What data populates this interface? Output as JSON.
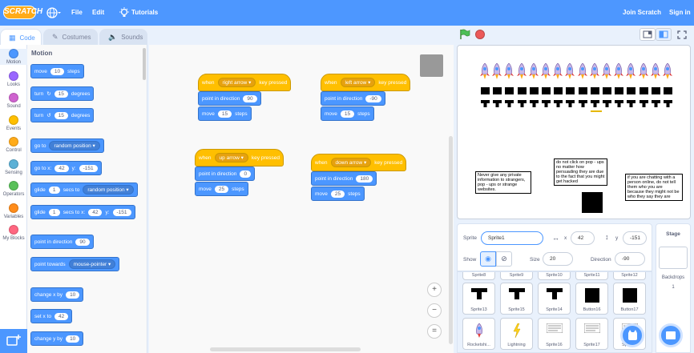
{
  "menu": {
    "logo": "SCRATCH",
    "file": "File",
    "edit": "Edit",
    "tutorials": "Tutorials",
    "join": "Join Scratch",
    "signin": "Sign in"
  },
  "tabs": {
    "code": "Code",
    "costumes": "Costumes",
    "sounds": "Sounds"
  },
  "categories": [
    {
      "label": "Motion",
      "color": "#4c97ff"
    },
    {
      "label": "Looks",
      "color": "#9966ff"
    },
    {
      "label": "Sound",
      "color": "#cf63cf"
    },
    {
      "label": "Events",
      "color": "#ffbf00"
    },
    {
      "label": "Control",
      "color": "#ffab19"
    },
    {
      "label": "Sensing",
      "color": "#5cb1d6"
    },
    {
      "label": "Operators",
      "color": "#59c059"
    },
    {
      "label": "Variables",
      "color": "#ff8c1a"
    },
    {
      "label": "My Blocks",
      "color": "#ff6680"
    }
  ],
  "palette": {
    "heading": "Motion",
    "move": "move",
    "move_val": "10",
    "steps": "steps",
    "turn": "turn",
    "turn_cw_val": "15",
    "turn_ccw_val": "15",
    "degrees": "degrees",
    "goto": "go to",
    "goto_opt": "random position",
    "gotoxy": "go to x:",
    "gotoxy_x": "42",
    "gotoxy_y_lbl": "y:",
    "gotoxy_y": "-151",
    "glide": "glide",
    "glide_val": "1",
    "secs_to": "secs to",
    "glide_opt": "random position",
    "glide2_val": "1",
    "glide2_x_lbl": "secs to x:",
    "glide2_x": "42",
    "glide2_y_lbl": "y:",
    "glide2_y": "-151",
    "point_dir": "point in direction",
    "point_dir_val": "90",
    "point_towards": "point towards",
    "point_towards_opt": "mouse-pointer",
    "change_x": "change x by",
    "change_x_val": "10",
    "set_x": "set x to",
    "set_x_val": "42",
    "change_y": "change y by",
    "change_y_val": "10"
  },
  "scripts": [
    {
      "when": "when",
      "key": "right arrow",
      "pressed": "key pressed",
      "point": "point in direction",
      "dir": "90",
      "move": "move",
      "steps_val": "15",
      "steps": "steps"
    },
    {
      "when": "when",
      "key": "left arrow",
      "pressed": "key pressed",
      "point": "point in direction",
      "dir": "-90",
      "move": "move",
      "steps_val": "15",
      "steps": "steps"
    },
    {
      "when": "when",
      "key": "up arrow",
      "pressed": "key pressed",
      "point": "point in direction",
      "dir": "0",
      "move": "move",
      "steps_val": "25",
      "steps": "steps"
    },
    {
      "when": "when",
      "key": "down arrow",
      "pressed": "key pressed",
      "point": "point in direction",
      "dir": "180",
      "move": "move",
      "steps_val": "25",
      "steps": "steps"
    }
  ],
  "stage_notes": [
    "Never give any private information to strangers, pop - ups or strange websites.",
    "do not click on pop - ups no matter how persuading they are due to the fact that you might get hacked",
    "if you are chatting with a person online, do not tell them who you are because they might not be who they say they are"
  ],
  "sprite_info": {
    "sprite_lbl": "Sprite",
    "sprite_name": "Sprite1",
    "x_lbl": "x",
    "x": "42",
    "y_lbl": "y",
    "y": "-151",
    "show_lbl": "Show",
    "size_lbl": "Size",
    "size": "20",
    "dir_lbl": "Direction",
    "dir": "-90"
  },
  "sprite_tiles_top": [
    "Sprite8",
    "Sprite9",
    "Sprite10",
    "Sprite11",
    "Sprite12"
  ],
  "sprite_tiles": [
    {
      "name": "Sprite13",
      "icon": "t-shape-icon"
    },
    {
      "name": "Sprite15",
      "icon": "t-shape-icon"
    },
    {
      "name": "Sprite14",
      "icon": "t-shape-icon"
    },
    {
      "name": "Button16",
      "icon": "black-square-icon"
    },
    {
      "name": "Button17",
      "icon": "black-square-icon"
    },
    {
      "name": "Rocketshi...",
      "icon": "rocket-icon"
    },
    {
      "name": "Lightning",
      "icon": "lightning-icon"
    },
    {
      "name": "Sprite16",
      "icon": "text-card-icon"
    },
    {
      "name": "Sprite17",
      "icon": "text-card-icon"
    },
    {
      "name": "Sprite...",
      "icon": "text-card-icon"
    }
  ],
  "stage_panel": {
    "title": "Stage",
    "backdrops_lbl": "Backdrops",
    "backdrops": "1"
  }
}
